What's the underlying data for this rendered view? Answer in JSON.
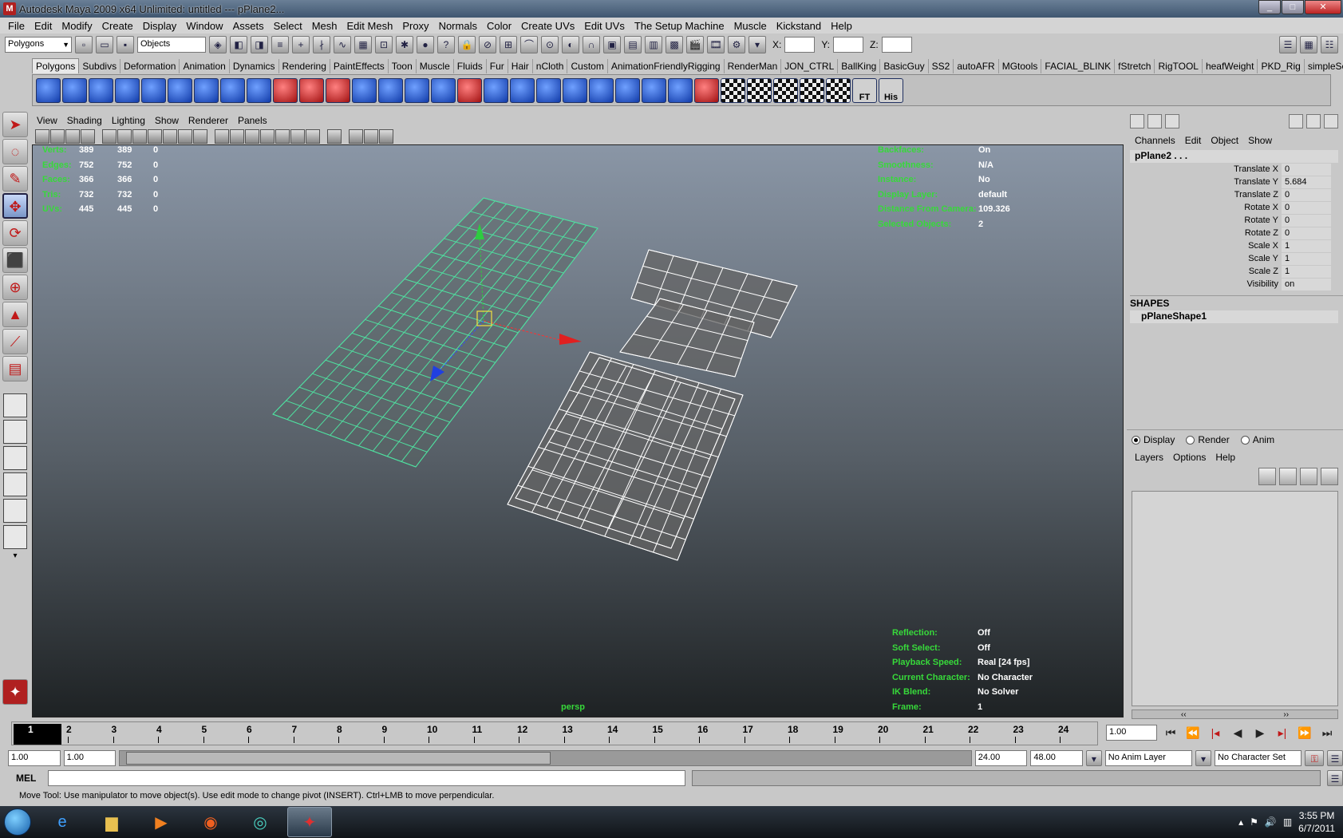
{
  "window": {
    "title": "Autodesk Maya 2009 x64 Unlimited: untitled   ---   pPlane2...",
    "app_icon": "maya-icon",
    "controls": [
      "minimize",
      "maximize",
      "close"
    ]
  },
  "menubar": [
    "File",
    "Edit",
    "Modify",
    "Create",
    "Display",
    "Window",
    "Assets",
    "Select",
    "Mesh",
    "Edit Mesh",
    "Proxy",
    "Normals",
    "Color",
    "Create UVs",
    "Edit UVs",
    "The Setup Machine",
    "Muscle",
    "Kickstand",
    "Help"
  ],
  "statusline": {
    "menuset": "Polygons",
    "selection_mode": "Objects",
    "x_label": "X:",
    "y_label": "Y:",
    "z_label": "Z:"
  },
  "shelf_tabs": [
    "Polygons",
    "Subdivs",
    "Deformation",
    "Animation",
    "Dynamics",
    "Rendering",
    "PaintEffects",
    "Toon",
    "Muscle",
    "Fluids",
    "Fur",
    "Hair",
    "nCloth",
    "Custom",
    "AnimationFriendlyRigging",
    "RenderMan",
    "JON_CTRL",
    "BallKing",
    "BasicGuy",
    "SS2",
    "autoAFR",
    "MGtools",
    "FACIAL_BLINK",
    "fStretch",
    "RigTOOL",
    "heafWeight",
    "PKD_Rig",
    "simpleSel"
  ],
  "active_shelf_tab": "Polygons",
  "shelf_labels": {
    "ft": "FT",
    "his": "His"
  },
  "panel_menu": [
    "View",
    "Shading",
    "Lighting",
    "Show",
    "Renderer",
    "Panels"
  ],
  "viewport": {
    "camera": "persp",
    "hud_left": [
      {
        "label": "Verts:",
        "a": "389",
        "b": "389",
        "c": "0"
      },
      {
        "label": "Edges:",
        "a": "752",
        "b": "752",
        "c": "0"
      },
      {
        "label": "Faces:",
        "a": "366",
        "b": "366",
        "c": "0"
      },
      {
        "label": "Tris:",
        "a": "732",
        "b": "732",
        "c": "0"
      },
      {
        "label": "UVs:",
        "a": "445",
        "b": "445",
        "c": "0"
      }
    ],
    "hud_right_top": [
      {
        "label": "Backfaces:",
        "value": "On"
      },
      {
        "label": "Smoothness:",
        "value": "N/A"
      },
      {
        "label": "Instance:",
        "value": "No"
      },
      {
        "label": "Display Layer:",
        "value": "default"
      },
      {
        "label": "Distance From Camera:",
        "value": "109.326"
      },
      {
        "label": "Selected Objects:",
        "value": "2"
      }
    ],
    "hud_right_bottom": [
      {
        "label": "Reflection:",
        "value": "Off"
      },
      {
        "label": "Soft Select:",
        "value": "Off"
      },
      {
        "label": "Playback Speed:",
        "value": "Real [24 fps]"
      },
      {
        "label": "Current Character:",
        "value": "No Character"
      },
      {
        "label": "IK Blend:",
        "value": "No Solver"
      },
      {
        "label": "Frame:",
        "value": "1"
      }
    ],
    "colors": {
      "selected_wire": "#4fe0a0",
      "wire": "#ffffff",
      "hud_label": "#37d93a"
    }
  },
  "channel_box": {
    "menu": [
      "Channels",
      "Edit",
      "Object",
      "Show"
    ],
    "object": "pPlane2 . . .",
    "attributes": [
      {
        "name": "Translate X",
        "value": "0"
      },
      {
        "name": "Translate Y",
        "value": "5.684"
      },
      {
        "name": "Translate Z",
        "value": "0"
      },
      {
        "name": "Rotate X",
        "value": "0"
      },
      {
        "name": "Rotate Y",
        "value": "0"
      },
      {
        "name": "Rotate Z",
        "value": "0"
      },
      {
        "name": "Scale X",
        "value": "1"
      },
      {
        "name": "Scale Y",
        "value": "1"
      },
      {
        "name": "Scale Z",
        "value": "1"
      },
      {
        "name": "Visibility",
        "value": "on"
      }
    ],
    "shapes_title": "SHAPES",
    "shape": "pPlaneShape1"
  },
  "layer_editor": {
    "modes": [
      "Display",
      "Render",
      "Anim"
    ],
    "selected_mode": "Display",
    "menu": [
      "Layers",
      "Options",
      "Help"
    ]
  },
  "time_slider": {
    "current_frame": "1",
    "ticks": [
      "2",
      "3",
      "4",
      "5",
      "6",
      "7",
      "8",
      "9",
      "10",
      "11",
      "12",
      "13",
      "14",
      "15",
      "16",
      "17",
      "18",
      "19",
      "20",
      "21",
      "22",
      "23",
      "24"
    ],
    "current_time_field": "1.00"
  },
  "range_slider": {
    "start": "1.00",
    "playback_start": "1.00",
    "playback_end": "24.00",
    "end": "48.00",
    "anim_layer": "No Anim Layer",
    "character_set": "No Character Set"
  },
  "command_line": {
    "label": "MEL"
  },
  "help_line": "Move Tool: Use manipulator to move object(s). Use edit mode to change pivot (INSERT).  Ctrl+LMB to move perpendicular.",
  "taskbar": {
    "clock_time": "3:55 PM",
    "clock_date": "6/7/2011"
  }
}
